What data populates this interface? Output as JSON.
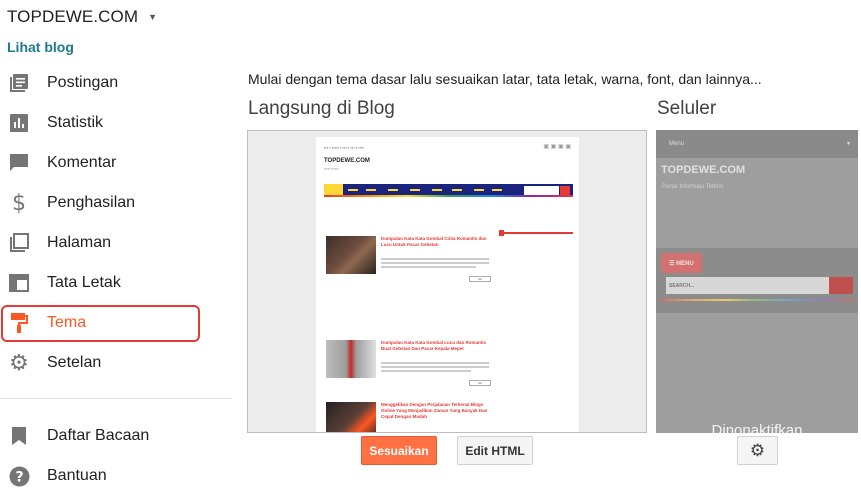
{
  "sidebar": {
    "blog_title": "TOPDEWE.COM",
    "view_blog": "Lihat blog",
    "items": [
      {
        "label": "Postingan",
        "icon": "posts-icon"
      },
      {
        "label": "Statistik",
        "icon": "stats-icon"
      },
      {
        "label": "Komentar",
        "icon": "comment-icon"
      },
      {
        "label": "Penghasilan",
        "icon": "dollar-icon"
      },
      {
        "label": "Halaman",
        "icon": "pages-icon"
      },
      {
        "label": "Tata Letak",
        "icon": "layout-icon"
      },
      {
        "label": "Tema",
        "icon": "paint-roller-icon",
        "active": true
      },
      {
        "label": "Setelan",
        "icon": "gear-icon"
      }
    ],
    "bottom_items": [
      {
        "label": "Daftar Bacaan",
        "icon": "bookmark-icon"
      },
      {
        "label": "Bantuan",
        "icon": "help-icon"
      }
    ]
  },
  "main": {
    "intro": "Mulai dengan tema dasar lalu sesuaikan latar, tata letak, warna, font, dan lainnya...",
    "live_title": "Langsung di Blog",
    "mobile_title": "Seluler",
    "customize_button": "Sesuaikan",
    "edit_html_button": "Edit HTML"
  },
  "preview": {
    "site_name": "TOPDEWE.COM",
    "posts": [
      "Kumpulan Kata Kata Gombal Cinta Romantis dan Lucu Untuk Pacar Gebetan",
      "Kumpulan Kata Kata Gombal Lucu dan Romantis Buat Gebetan Dan Pacar Kepala Mepet",
      "Menggelikan Dengan Perjalanan Terkenal Blogs Online Yang Menjadikan Zaman Yang Banyak Dan Cepat Dengan Mudah"
    ],
    "mobile_menu_label": "Menu",
    "mobile_site_name": "TOPDEWE.COM",
    "mobile_subtitle": "Portal Informasi Terkini",
    "mobile_menu_button": "☰ MENU",
    "mobile_search": "SEARCH...",
    "mobile_overlay": "Dinonaktifkan"
  },
  "colors": {
    "accent": "#ff5722",
    "button": "#ff7043",
    "link": "#1f7a8c",
    "highlight_border": "#e53935"
  }
}
